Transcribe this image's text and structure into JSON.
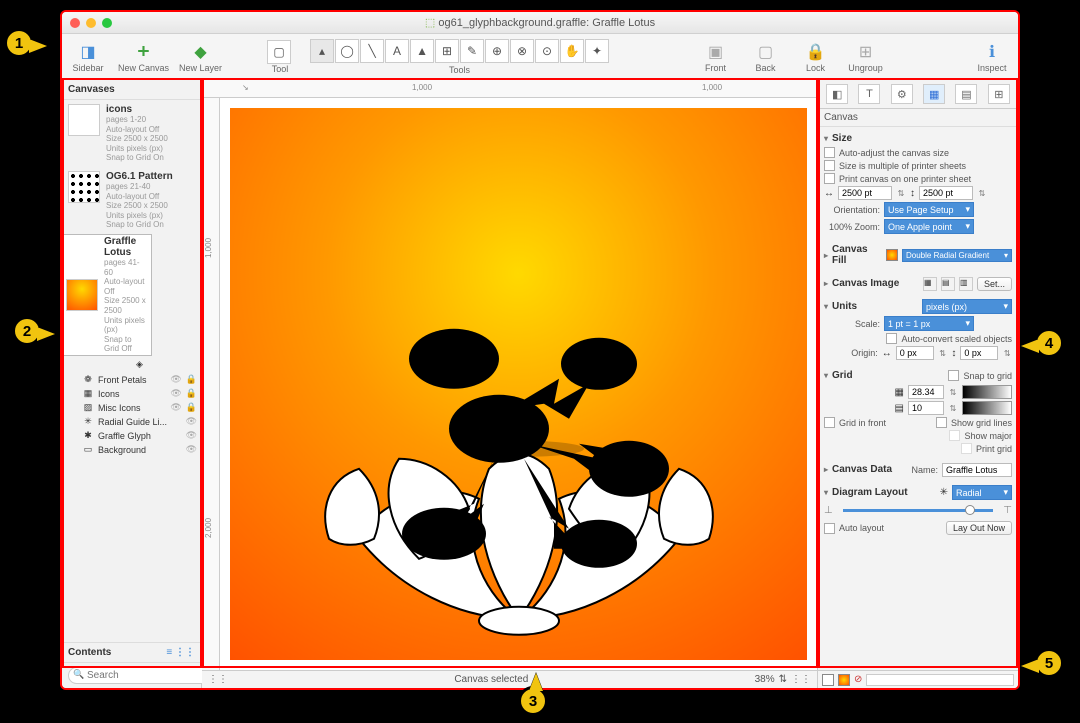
{
  "window": {
    "title_prefix": "og61_glyphbackground.graffle:",
    "title_doc": "Graffle Lotus"
  },
  "toolbar": {
    "sidebar": "Sidebar",
    "new_canvas": "New Canvas",
    "new_layer": "New Layer",
    "tool_label": "Tool",
    "tools_label": "Tools",
    "front": "Front",
    "back": "Back",
    "lock": "Lock",
    "ungroup": "Ungroup",
    "inspect": "Inspect"
  },
  "sidebar": {
    "header": "Canvases",
    "contents": "Contents",
    "search_placeholder": "Search",
    "canvases": [
      {
        "name": "icons",
        "pages": "pages 1-20",
        "meta": [
          "Auto-layout Off",
          "Size 2500 x 2500",
          "Units pixels (px)",
          "Snap to Grid On"
        ]
      },
      {
        "name": "OG6.1 Pattern",
        "pages": "pages 21-40",
        "meta": [
          "Auto-layout Off",
          "Size 2500 x 2500",
          "Units pixels (px)",
          "Snap to Grid On"
        ]
      },
      {
        "name": "Graffle Lotus",
        "pages": "pages 41-60",
        "meta": [
          "Auto-layout Off",
          "Size 2500 x 2500",
          "Units pixels (px)",
          "Snap to Grid Off"
        ]
      }
    ],
    "layers": [
      "Front Petals",
      "Icons",
      "Misc Icons",
      "Radial Guide Li...",
      "Graffle Glyph",
      "Background"
    ]
  },
  "ruler": {
    "h": [
      "1,000",
      "1,000"
    ],
    "v": [
      "1,000",
      "2,000"
    ]
  },
  "status": {
    "center": "Canvas selected",
    "zoom": "38%"
  },
  "inspector": {
    "header": "Canvas",
    "size": {
      "title": "Size",
      "auto_adjust": "Auto-adjust the canvas size",
      "multiple": "Size is multiple of printer sheets",
      "one_sheet": "Print canvas on one printer sheet",
      "w": "2500 pt",
      "h": "2500 pt",
      "orientation_label": "Orientation:",
      "orientation": "Use Page Setup",
      "zoom_label": "100% Zoom:",
      "zoom": "One Apple point"
    },
    "fill": {
      "title": "Canvas Fill",
      "value": "Double Radial Gradient"
    },
    "image": {
      "title": "Canvas Image",
      "set": "Set..."
    },
    "units": {
      "title": "Units",
      "value": "pixels (px)",
      "scale_label": "Scale:",
      "scale": "1 pt = 1 px",
      "auto_convert": "Auto-convert scaled objects",
      "origin_label": "Origin:",
      "ox": "0 px",
      "oy": "0 px"
    },
    "grid": {
      "title": "Grid",
      "snap": "Snap to grid",
      "major": "28.34",
      "minor": "10",
      "front": "Grid in front",
      "show_lines": "Show grid lines",
      "show_major": "Show major",
      "print": "Print grid"
    },
    "data": {
      "title": "Canvas Data",
      "name_label": "Name:",
      "name": "Graffle Lotus"
    },
    "layout": {
      "title": "Diagram Layout",
      "type": "Radial",
      "auto": "Auto layout",
      "now": "Lay Out Now"
    }
  },
  "callouts": {
    "1": "1",
    "2": "2",
    "3": "3",
    "4": "4",
    "5": "5"
  }
}
